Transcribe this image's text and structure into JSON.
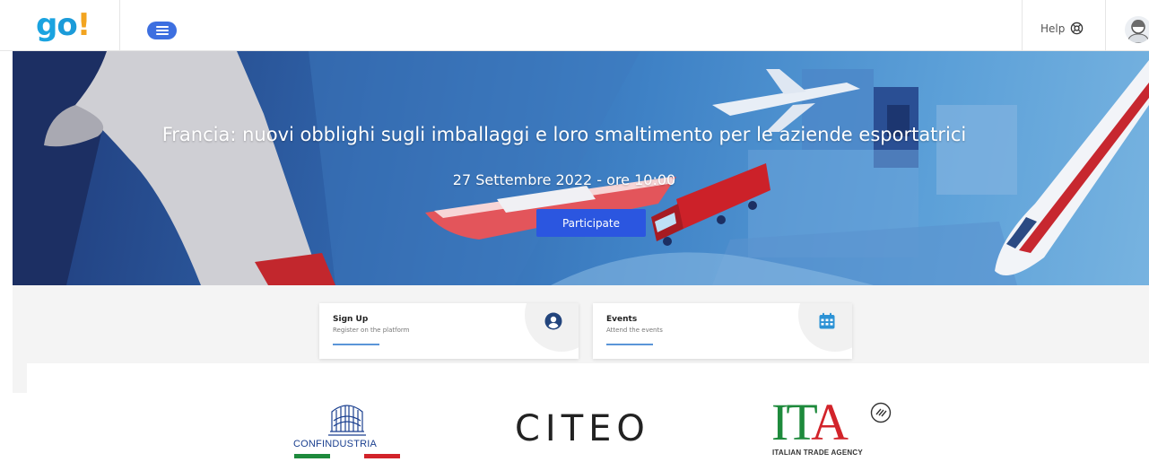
{
  "header": {
    "logo": {
      "g": "g",
      "o": "o",
      "excl": "!"
    },
    "help_label": "Help",
    "icons": {
      "menu": "hamburger-menu-icon",
      "help": "lifebuoy-icon",
      "avatar": "user-avatar-icon"
    }
  },
  "hero": {
    "title": "Francia: nuovi obblighi sugli imballaggi e loro smaltimento per le aziende esportatrici",
    "date": "27 Settembre 2022 - ore 10:00",
    "cta_label": "Participate"
  },
  "cards": [
    {
      "title": "Sign Up",
      "subtitle": "Register on the platform",
      "icon": "user-circle-icon",
      "icon_color": "#23457d"
    },
    {
      "title": "Events",
      "subtitle": "Attend the events",
      "icon": "calendar-icon",
      "icon_color": "#2c92d5"
    }
  ],
  "partners": {
    "confindustria": "CONFINDUSTRIA",
    "citeo": "CITEO",
    "ita": {
      "letters": [
        "I",
        "T",
        "A"
      ],
      "subtitle": "ITALIAN TRADE AGENCY"
    }
  },
  "colors": {
    "brand_blue": "#2b56e0",
    "menu_button": "#3d6fe0",
    "accent_line": "#5b95d8",
    "italian_green": "#1e8a3c",
    "italian_red": "#d2232a"
  }
}
